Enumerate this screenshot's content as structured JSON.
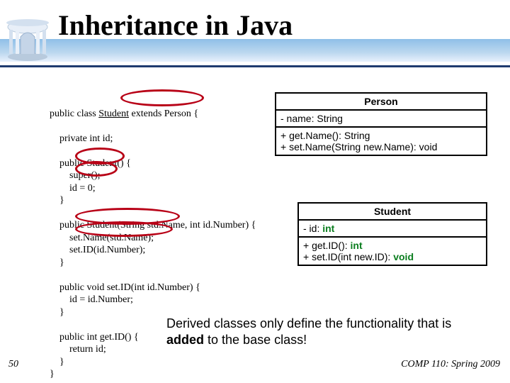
{
  "title": "Inheritance in Java",
  "code": {
    "l1": "public class ",
    "l1b": "Student",
    "l1c": " extends Person {",
    "l2": "    private int id;",
    "l3": "    public Student() {",
    "l4": "        super();",
    "l5": "        id = 0;",
    "l6": "    }",
    "l7": "    public Student(String std.Name, int id.Number) {",
    "l8": "        set.Name(std.Name);",
    "l9": "        set.ID(id.Number);",
    "l10": "    }",
    "l11": "    public void set.ID(int id.Number) {",
    "l12": "        id = id.Number;",
    "l13": "    }",
    "l14": "    public int get.ID() {",
    "l15": "        return id;",
    "l16": "    }",
    "l17": "}"
  },
  "uml_person": {
    "title": "Person",
    "attr": "- name: String",
    "m1": "+ get.Name(): String",
    "m2": "+ set.Name(String new.Name): void"
  },
  "uml_student": {
    "title": "Student",
    "attr_pre": "- id: ",
    "attr_add": "int",
    "m1_pre": "+ get.ID(): ",
    "m1_add": "int",
    "m2_pre": "+ set.ID(int new.ID): ",
    "m2_add": "void"
  },
  "summary": {
    "pre": "Derived classes only define the functionality that is ",
    "bold": "added",
    "post": " to the base class!"
  },
  "footer": {
    "left": "50",
    "right": "COMP 110: Spring 2009"
  }
}
